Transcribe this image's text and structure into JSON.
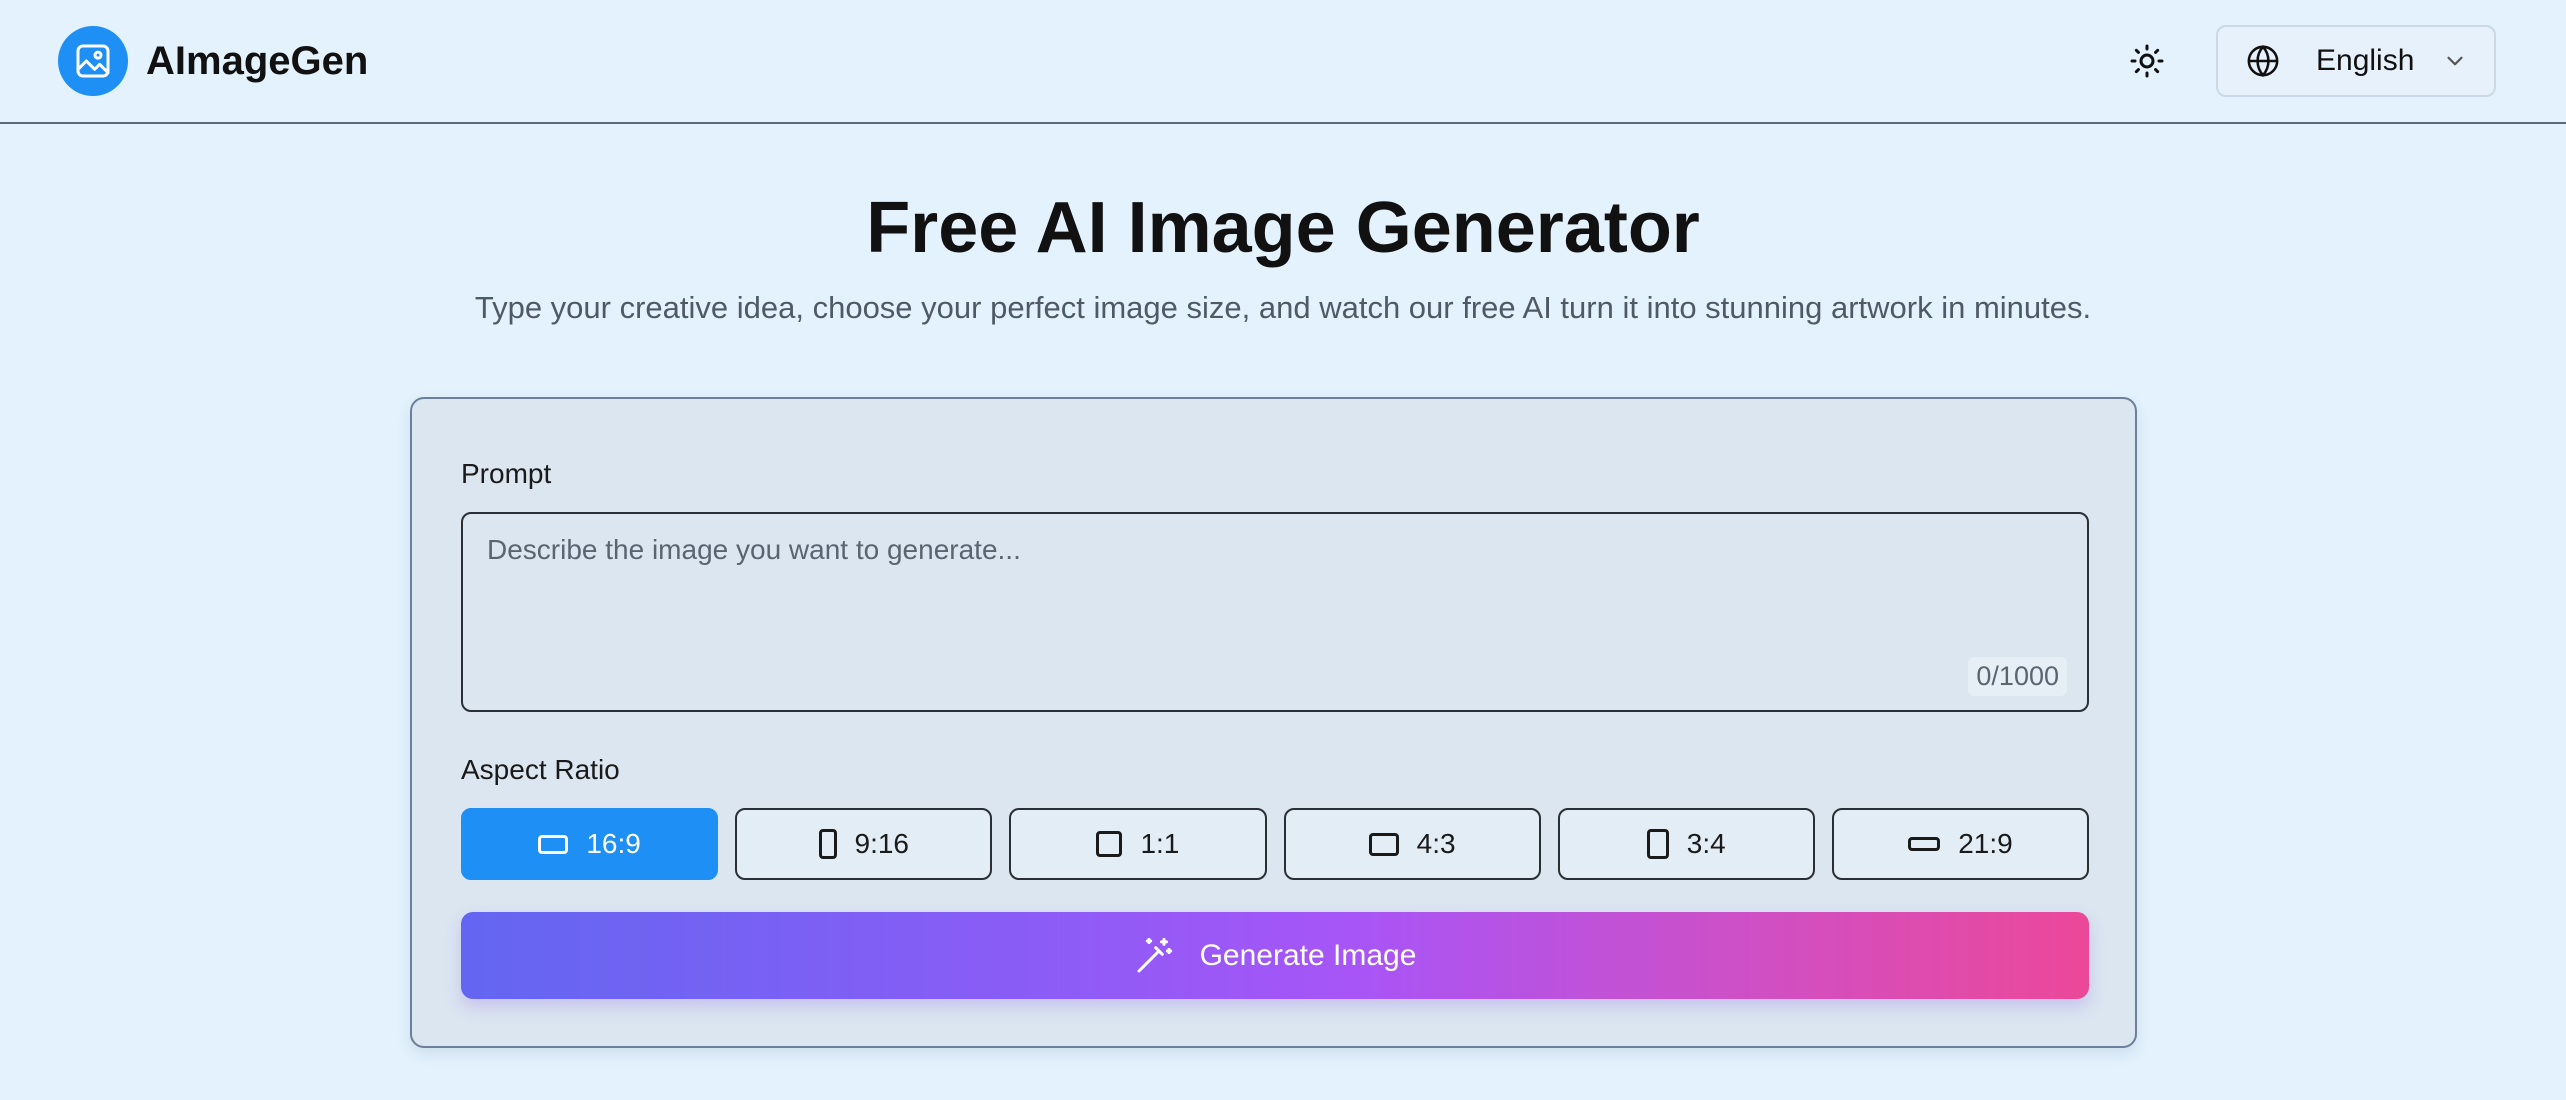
{
  "header": {
    "brand_name": "AImageGen",
    "logo_icon": "image-icon",
    "theme_icon": "sun-icon",
    "language": {
      "icon": "globe-icon",
      "selected": "English",
      "chevron_icon": "chevron-down-icon"
    }
  },
  "hero": {
    "title": "Free AI Image Generator",
    "subtitle": "Type your creative idea, choose your perfect image size, and watch our free AI turn it into stunning artwork in minutes."
  },
  "form": {
    "prompt_label": "Prompt",
    "prompt_placeholder": "Describe the image you want to generate...",
    "prompt_value": "",
    "char_counter": "0/1000",
    "aspect_label": "Aspect Ratio",
    "ratios": [
      {
        "label": "16:9",
        "active": true
      },
      {
        "label": "9:16",
        "active": false
      },
      {
        "label": "1:1",
        "active": false
      },
      {
        "label": "4:3",
        "active": false
      },
      {
        "label": "3:4",
        "active": false
      },
      {
        "label": "21:9",
        "active": false
      }
    ],
    "generate_label": "Generate Image",
    "generate_icon": "magic-wand-icon"
  },
  "colors": {
    "background": "#e3f2fd",
    "accent": "#1e90f5",
    "gradient_start": "#6366f1",
    "gradient_end": "#ec4899"
  }
}
